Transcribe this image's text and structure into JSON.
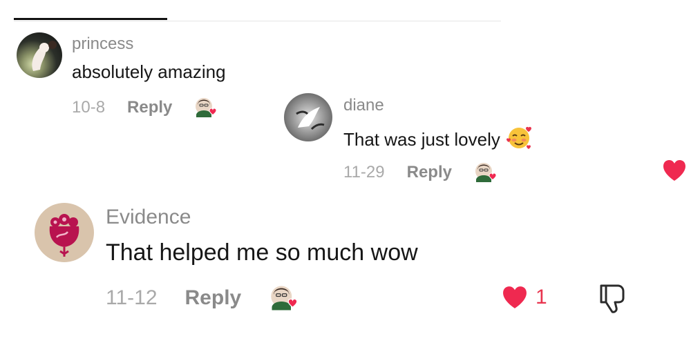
{
  "comments": [
    {
      "username": "princess",
      "text": "absolutely amazing",
      "date": "10-8",
      "reply_label": "Reply"
    },
    {
      "username": "diane",
      "text": "That was just lovely",
      "emoji": "smiling-face-with-hearts-emoji",
      "date": "11-29",
      "reply_label": "Reply",
      "liked": true
    },
    {
      "username": "Evidence",
      "text": "That helped me so much wow",
      "date": "11-12",
      "reply_label": "Reply",
      "liked": true,
      "like_count": "1"
    }
  ],
  "colors": {
    "like_red": "#ef2950",
    "text_dark": "#161616",
    "text_gray": "#8a8a8a",
    "date_gray": "#a9a9a9"
  }
}
